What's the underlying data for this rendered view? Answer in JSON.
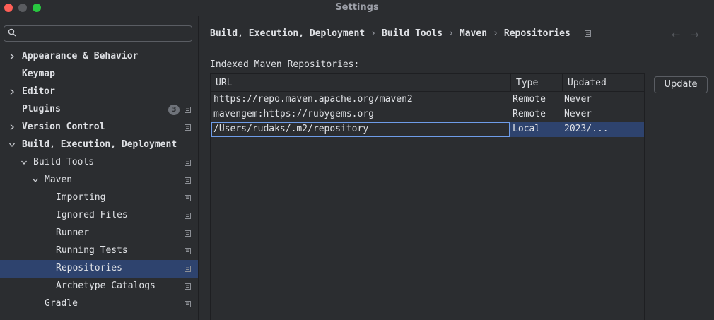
{
  "window": {
    "title": "Settings"
  },
  "search": {
    "value": "",
    "placeholder": ""
  },
  "sidebar": {
    "items": [
      {
        "label": "Appearance & Behavior",
        "bold": true,
        "expanded": false
      },
      {
        "label": "Keymap",
        "bold": true
      },
      {
        "label": "Editor",
        "bold": true,
        "expanded": false
      },
      {
        "label": "Plugins",
        "bold": true,
        "badge": "3"
      },
      {
        "label": "Version Control",
        "bold": true,
        "expanded": false
      },
      {
        "label": "Build, Execution, Deployment",
        "bold": true,
        "expanded": true
      },
      {
        "label": "Build Tools",
        "expanded": true
      },
      {
        "label": "Maven",
        "expanded": true
      },
      {
        "label": "Importing"
      },
      {
        "label": "Ignored Files"
      },
      {
        "label": "Runner"
      },
      {
        "label": "Running Tests"
      },
      {
        "label": "Repositories",
        "selected": true
      },
      {
        "label": "Archetype Catalogs"
      },
      {
        "label": "Gradle"
      }
    ]
  },
  "breadcrumb": [
    "Build, Execution, Deployment",
    "Build Tools",
    "Maven",
    "Repositories"
  ],
  "main": {
    "section_label": "Indexed Maven Repositories:",
    "update_label": "Update"
  },
  "table": {
    "columns": [
      "URL",
      "Type",
      "Updated"
    ],
    "rows": [
      {
        "url": "https://repo.maven.apache.org/maven2",
        "type": "Remote",
        "updated": "Never"
      },
      {
        "url": "mavengem:https://rubygems.org",
        "type": "Remote",
        "updated": "Never"
      },
      {
        "url": "/Users/rudaks/.m2/repository",
        "type": "Local",
        "updated": "2023/..."
      }
    ]
  },
  "colors": {
    "background": "#2b2d30",
    "selection": "#2e436e",
    "focus_border": "#6e9ce8",
    "text": "#dfe1e5"
  },
  "icons": {
    "search": "search-icon",
    "expand": "chevron-right-icon",
    "collapse": "chevron-down-icon",
    "settings_scope": "project-settings-icon",
    "back": "arrow-left-icon",
    "forward": "arrow-right-icon"
  }
}
